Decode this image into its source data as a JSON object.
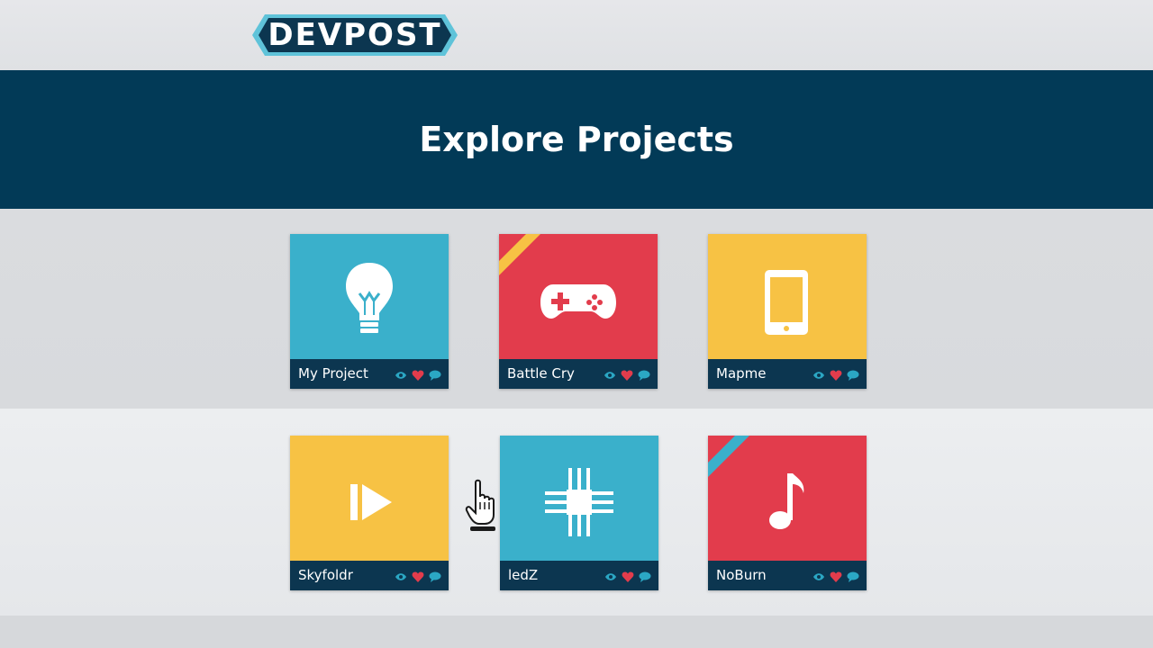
{
  "brand": {
    "logo_text": "DEVPOST"
  },
  "page": {
    "title": "Explore Projects"
  },
  "colors": {
    "navy": "#023a57",
    "footer": "#0c3650",
    "blue": "#3ab0cb",
    "red": "#e23c4c",
    "yellow": "#f7c244",
    "eye": "#2ba7c4",
    "heart": "#e23c4c",
    "comment": "#2ba7c4"
  },
  "projects": [
    {
      "title": "My Project",
      "color": "blue",
      "icon": "lightbulb-icon",
      "ribbon": null
    },
    {
      "title": "Battle Cry",
      "color": "red",
      "icon": "gamepad-icon",
      "ribbon": "yellow"
    },
    {
      "title": "Mapme",
      "color": "yellow",
      "icon": "smartphone-icon",
      "ribbon": null
    },
    {
      "title": "Skyfoldr",
      "color": "yellow",
      "icon": "play-icon",
      "ribbon": null
    },
    {
      "title": "ledZ",
      "color": "blue",
      "icon": "chip-icon",
      "ribbon": null
    },
    {
      "title": "NoBurn",
      "color": "red",
      "icon": "music-note-icon",
      "ribbon": "blue"
    }
  ],
  "stats_icons": [
    "eye-icon",
    "heart-icon",
    "comment-icon"
  ],
  "cursor": {
    "icon": "hand-pointer-icon"
  }
}
